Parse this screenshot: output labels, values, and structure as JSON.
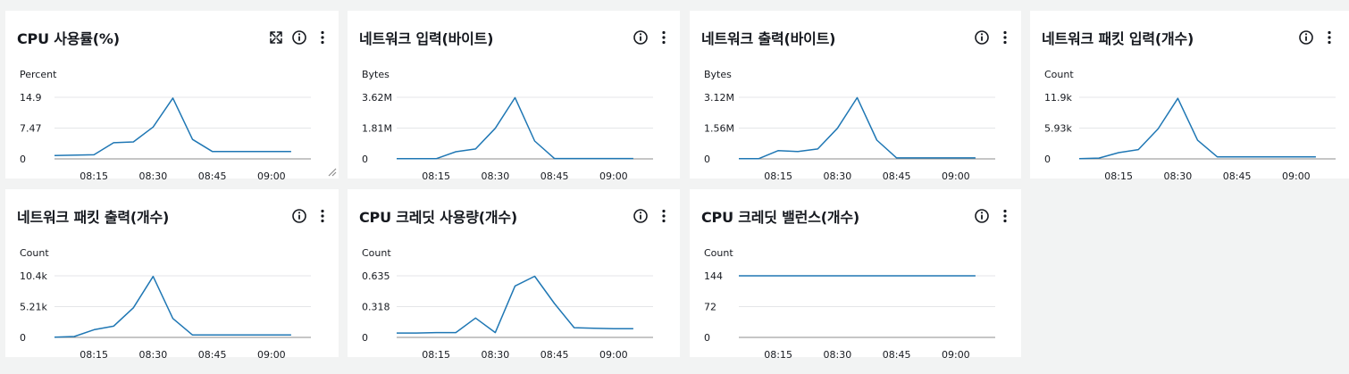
{
  "panels": [
    {
      "title": "CPU 사용률(%)",
      "icons": [
        "expand-icon",
        "info-icon",
        "more-vert-icon"
      ],
      "chart_data": {
        "type": "line",
        "ylabel": "Percent",
        "yticks": [
          "0",
          "7.47",
          "14.9"
        ],
        "ylim": [
          0,
          14.9
        ],
        "xticks": [
          "08:15",
          "08:30",
          "08:45",
          "09:00"
        ],
        "xlim": [
          5,
          70
        ],
        "x": [
          5,
          15,
          20,
          25,
          30,
          35,
          40,
          45,
          50,
          55,
          60,
          65
        ],
        "values": [
          0.8,
          1.0,
          3.9,
          4.1,
          7.7,
          14.7,
          4.7,
          1.8,
          1.8,
          1.8,
          1.8,
          1.8
        ],
        "color": "#1f77b4"
      }
    },
    {
      "title": "네트워크 입력(바이트)",
      "icons": [
        "info-icon",
        "more-vert-icon"
      ],
      "chart_data": {
        "type": "line",
        "ylabel": "Bytes",
        "yticks": [
          "0",
          "1.81M",
          "3.62M"
        ],
        "ylim": [
          0,
          3.62
        ],
        "xticks": [
          "08:15",
          "08:30",
          "08:45",
          "09:00"
        ],
        "xlim": [
          5,
          70
        ],
        "x": [
          5,
          10,
          15,
          20,
          25,
          30,
          35,
          40,
          45,
          50,
          55,
          60,
          65
        ],
        "values": [
          0.01,
          0.01,
          0.01,
          0.42,
          0.58,
          1.8,
          3.6,
          1.05,
          0.02,
          0.02,
          0.02,
          0.02,
          0.02
        ],
        "color": "#1f77b4"
      }
    },
    {
      "title": "네트워크 출력(바이트)",
      "icons": [
        "info-icon",
        "more-vert-icon"
      ],
      "chart_data": {
        "type": "line",
        "ylabel": "Bytes",
        "yticks": [
          "0",
          "1.56M",
          "3.12M"
        ],
        "ylim": [
          0,
          3.12
        ],
        "xticks": [
          "08:15",
          "08:30",
          "08:45",
          "09:00"
        ],
        "xlim": [
          5,
          70
        ],
        "x": [
          5,
          10,
          15,
          20,
          25,
          30,
          35,
          40,
          45,
          50,
          55,
          60,
          65
        ],
        "values": [
          0.01,
          0.01,
          0.42,
          0.37,
          0.5,
          1.55,
          3.1,
          0.95,
          0.05,
          0.05,
          0.05,
          0.05,
          0.05
        ],
        "color": "#1f77b4"
      }
    },
    {
      "title": "네트워크 패킷 입력(개수)",
      "icons": [
        "info-icon",
        "more-vert-icon"
      ],
      "chart_data": {
        "type": "line",
        "ylabel": "Count",
        "yticks": [
          "0",
          "5.93k",
          "11.9k"
        ],
        "ylim": [
          0,
          11.9
        ],
        "xticks": [
          "08:15",
          "08:30",
          "08:45",
          "09:00"
        ],
        "xlim": [
          5,
          70
        ],
        "x": [
          5,
          10,
          15,
          20,
          25,
          30,
          35,
          40,
          45,
          50,
          55,
          60,
          65
        ],
        "values": [
          0.05,
          0.15,
          1.2,
          1.8,
          5.8,
          11.7,
          3.6,
          0.4,
          0.4,
          0.4,
          0.4,
          0.4,
          0.4
        ],
        "color": "#1f77b4"
      }
    },
    {
      "title": "네트워크 패킷 출력(개수)",
      "icons": [
        "info-icon",
        "more-vert-icon"
      ],
      "chart_data": {
        "type": "line",
        "ylabel": "Count",
        "yticks": [
          "0",
          "5.21k",
          "10.4k"
        ],
        "ylim": [
          0,
          10.4
        ],
        "xticks": [
          "08:15",
          "08:30",
          "08:45",
          "09:00"
        ],
        "xlim": [
          5,
          70
        ],
        "x": [
          5,
          10,
          15,
          20,
          25,
          30,
          35,
          40,
          45,
          50,
          55,
          60,
          65
        ],
        "values": [
          0.05,
          0.15,
          1.3,
          1.9,
          5.0,
          10.3,
          3.2,
          0.4,
          0.4,
          0.4,
          0.4,
          0.4,
          0.4
        ],
        "color": "#1f77b4"
      }
    },
    {
      "title": "CPU 크레딧 사용량(개수)",
      "icons": [
        "info-icon",
        "more-vert-icon"
      ],
      "chart_data": {
        "type": "line",
        "ylabel": "Count",
        "yticks": [
          "0",
          "0.318",
          "0.635"
        ],
        "ylim": [
          0,
          0.635
        ],
        "xticks": [
          "08:15",
          "08:30",
          "08:45",
          "09:00"
        ],
        "xlim": [
          5,
          70
        ],
        "x": [
          5,
          10,
          15,
          20,
          25,
          30,
          35,
          40,
          45,
          50,
          55,
          60,
          65
        ],
        "values": [
          0.045,
          0.045,
          0.05,
          0.05,
          0.2,
          0.05,
          0.53,
          0.63,
          0.35,
          0.1,
          0.095,
          0.09,
          0.09
        ],
        "color": "#1f77b4"
      }
    },
    {
      "title": "CPU 크레딧 밸런스(개수)",
      "icons": [
        "info-icon",
        "more-vert-icon"
      ],
      "chart_data": {
        "type": "line",
        "ylabel": "Count",
        "yticks": [
          "0",
          "72",
          "144"
        ],
        "ylim": [
          0,
          144
        ],
        "xticks": [
          "08:15",
          "08:30",
          "08:45",
          "09:00"
        ],
        "xlim": [
          5,
          70
        ],
        "x": [
          5,
          65
        ],
        "values": [
          144,
          144
        ],
        "color": "#1f77b4"
      }
    }
  ]
}
